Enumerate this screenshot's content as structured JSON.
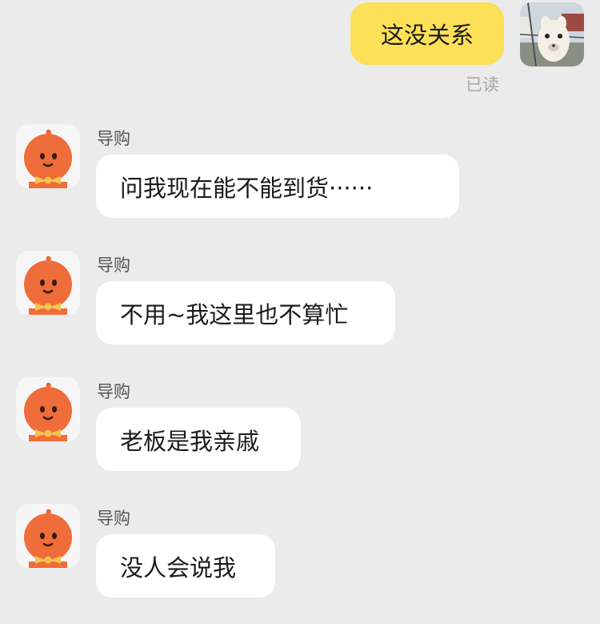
{
  "outgoing": {
    "text": "这没关系",
    "status": "已读"
  },
  "incoming": [
    {
      "sender": "导购",
      "text": "问我现在能不能到货······"
    },
    {
      "sender": "导购",
      "text": "不用~我这里也不算忙"
    },
    {
      "sender": "导购",
      "text": "老板是我亲戚"
    },
    {
      "sender": "导购",
      "text": "没人会说我"
    }
  ]
}
